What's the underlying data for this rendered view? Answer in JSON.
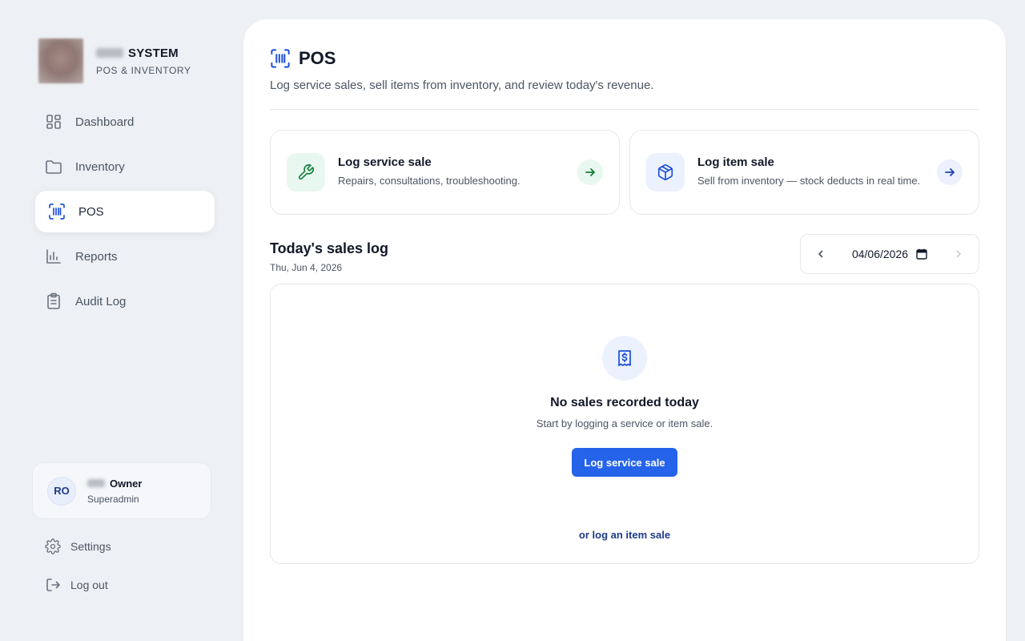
{
  "brand": {
    "title": "SYSTEM",
    "subtitle": "POS & INVENTORY",
    "logo_icon": "blurred-logo"
  },
  "nav": {
    "items": [
      {
        "label": "Dashboard",
        "icon": "grid-icon",
        "active": false
      },
      {
        "label": "Inventory",
        "icon": "folder-icon",
        "active": false
      },
      {
        "label": "POS",
        "icon": "barcode-scan-icon",
        "active": true
      },
      {
        "label": "Reports",
        "icon": "bar-chart-icon",
        "active": false
      },
      {
        "label": "Audit Log",
        "icon": "clipboard-icon",
        "active": false
      }
    ]
  },
  "user": {
    "initials": "RO",
    "name": "Owner",
    "role": "Superadmin"
  },
  "footer": {
    "settings_label": "Settings",
    "logout_label": "Log out"
  },
  "page": {
    "title": "POS",
    "description": "Log service sales, sell items from inventory, and review today's revenue."
  },
  "actions": {
    "service": {
      "title": "Log service sale",
      "description": "Repairs, consultations, troubleshooting.",
      "icon": "wrench-icon"
    },
    "item": {
      "title": "Log item sale",
      "description": "Sell from inventory — stock deducts in real time.",
      "icon": "box-icon"
    }
  },
  "sales_log": {
    "title": "Today's sales log",
    "date_label": "Thu, Jun 4, 2026",
    "picker_value": "04/06/2026",
    "empty_title": "No sales recorded today",
    "empty_subtitle": "Start by logging a service or item sale.",
    "primary_button": "Log service sale",
    "secondary_link": "or log an item sale"
  },
  "colors": {
    "accent": "#2563eb",
    "service_green": "#15803d",
    "background": "#edf0f4"
  }
}
